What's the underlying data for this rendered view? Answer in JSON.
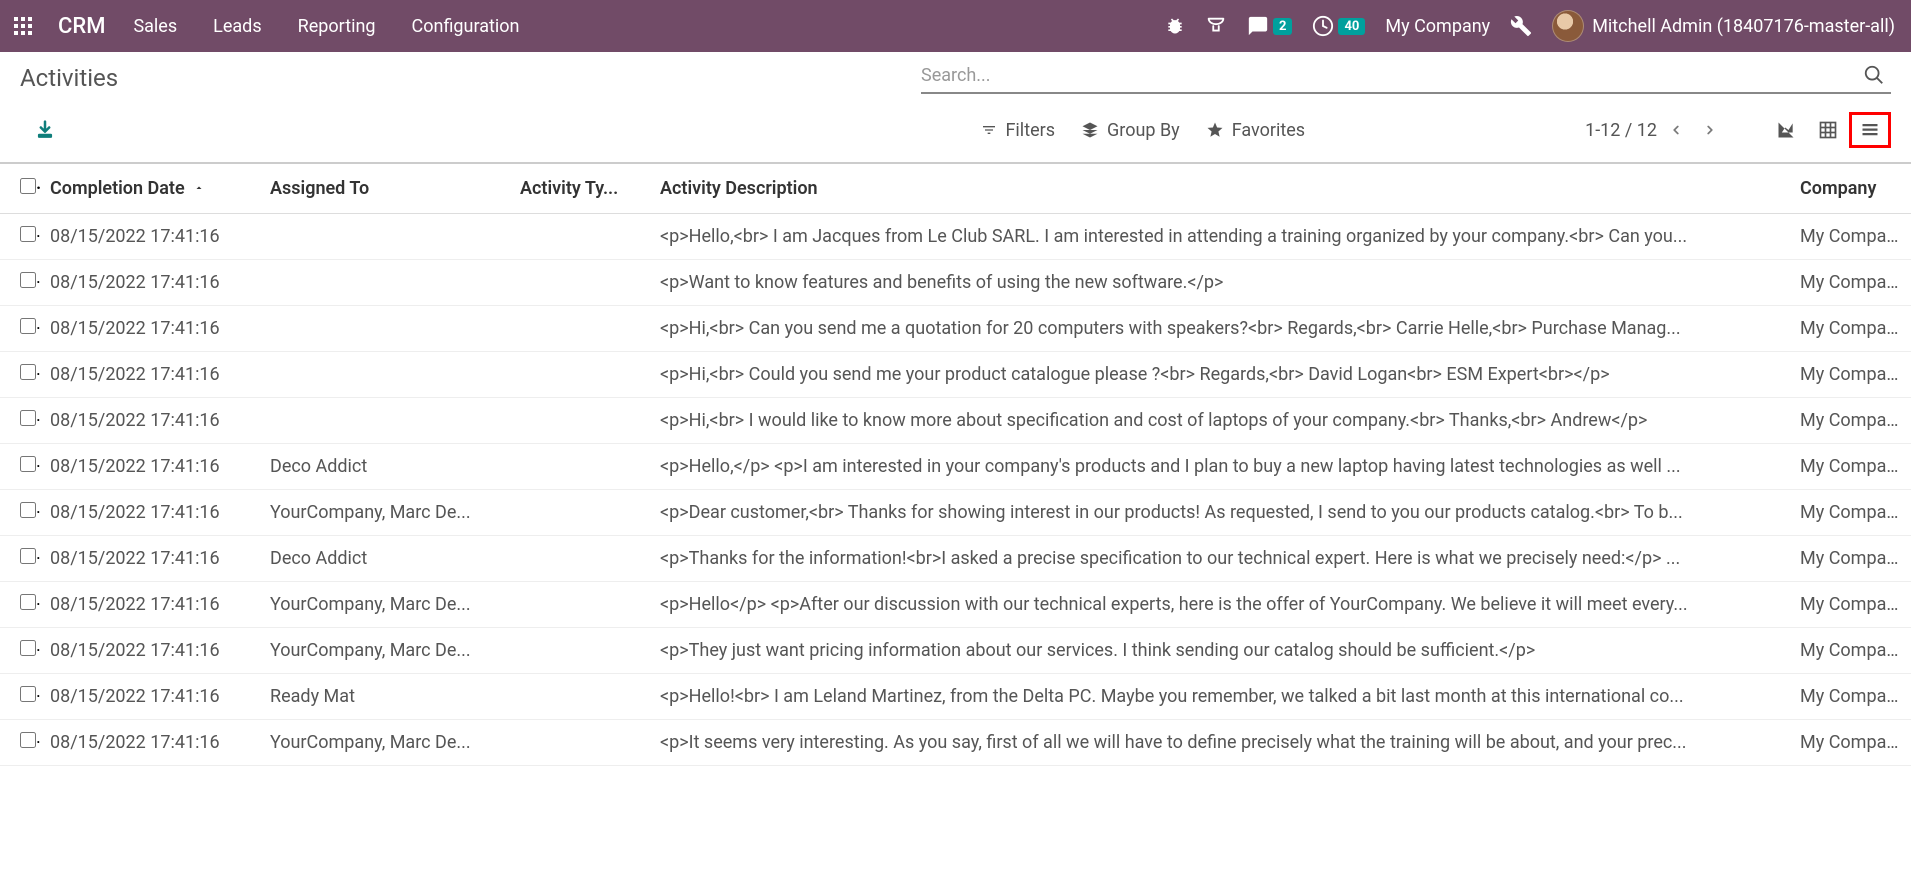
{
  "navbar": {
    "brand": "CRM",
    "menus": [
      "Sales",
      "Leads",
      "Reporting",
      "Configuration"
    ],
    "msg_count": "2",
    "clock_count": "40",
    "company": "My Company",
    "user": "Mitchell Admin (18407176-master-all)"
  },
  "page": {
    "title": "Activities",
    "search_placeholder": "Search...",
    "filters": "Filters",
    "groupby": "Group By",
    "favorites": "Favorites",
    "pager": "1-12 / 12"
  },
  "columns": {
    "date": "Completion Date",
    "assigned": "Assigned To",
    "type": "Activity Ty...",
    "desc": "Activity Description",
    "company": "Company"
  },
  "rows": [
    {
      "date": "08/15/2022 17:41:16",
      "assigned": "",
      "type": "",
      "desc": "<p>Hello,<br> I am Jacques from Le Club SARL. I am interested in attending a training organized by your company.<br> Can you...",
      "company": "My Compa..."
    },
    {
      "date": "08/15/2022 17:41:16",
      "assigned": "",
      "type": "",
      "desc": "<p>Want to know features and benefits of using the new software.</p>",
      "company": "My Compa..."
    },
    {
      "date": "08/15/2022 17:41:16",
      "assigned": "",
      "type": "",
      "desc": "<p>Hi,<br> Can you send me a quotation for 20 computers with speakers?<br> Regards,<br> Carrie Helle,<br> Purchase Manag...",
      "company": "My Compa..."
    },
    {
      "date": "08/15/2022 17:41:16",
      "assigned": "",
      "type": "",
      "desc": "<p>Hi,<br> Could you send me your product catalogue please ?<br> Regards,<br> David Logan<br> ESM Expert<br></p>",
      "company": "My Compa..."
    },
    {
      "date": "08/15/2022 17:41:16",
      "assigned": "",
      "type": "",
      "desc": "<p>Hi,<br> I would like to know more about specification and cost of laptops of your company.<br> Thanks,<br> Andrew</p>",
      "company": "My Compa..."
    },
    {
      "date": "08/15/2022 17:41:16",
      "assigned": "Deco Addict",
      "type": "",
      "desc": "<p>Hello,</p> <p>I am interested in your company's products and I plan to buy a new laptop having latest technologies as well ...",
      "company": "My Compa..."
    },
    {
      "date": "08/15/2022 17:41:16",
      "assigned": "YourCompany, Marc De...",
      "type": "",
      "desc": "<p>Dear customer,<br> Thanks for showing interest in our products! As requested, I send to you our products catalog.<br> To b...",
      "company": "My Compa..."
    },
    {
      "date": "08/15/2022 17:41:16",
      "assigned": "Deco Addict",
      "type": "",
      "desc": "<p>Thanks for the information!<br>I asked a precise specification to our technical expert. Here is what we precisely need:</p> ...",
      "company": "My Compa..."
    },
    {
      "date": "08/15/2022 17:41:16",
      "assigned": "YourCompany, Marc De...",
      "type": "",
      "desc": "<p>Hello</p> <p>After our discussion with our technical experts, here is the offer of YourCompany. We believe it will meet every...",
      "company": "My Compa..."
    },
    {
      "date": "08/15/2022 17:41:16",
      "assigned": "YourCompany, Marc De...",
      "type": "",
      "desc": "<p>They just want pricing information about our services. I think sending our catalog should be sufficient.</p>",
      "company": "My Compa..."
    },
    {
      "date": "08/15/2022 17:41:16",
      "assigned": "Ready Mat",
      "type": "",
      "desc": "<p>Hello!<br> I am Leland Martinez, from the Delta PC. Maybe you remember, we talked a bit last month at this international co...",
      "company": "My Compa..."
    },
    {
      "date": "08/15/2022 17:41:16",
      "assigned": "YourCompany, Marc De...",
      "type": "",
      "desc": "<p>It seems very interesting. As you say, first of all we will have to define precisely what the training will be about, and your prec...",
      "company": "My Compa..."
    }
  ]
}
